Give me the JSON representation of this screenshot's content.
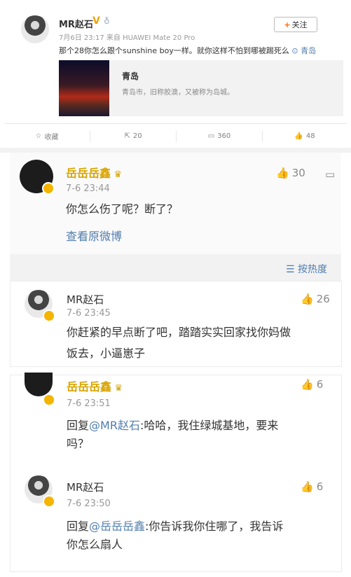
{
  "post": {
    "username": "MR赵石",
    "verified_badge": "V",
    "meta": "7月6日 23:17 来自 HUAWEI Mate 20 Pro",
    "follow_label": "关注",
    "text": "那个28你怎么跟个sunshine boy一样。就你这样不怕到哪被踢死么",
    "location": "青岛",
    "card": {
      "title": "青岛",
      "desc": "青岛市，旧称胶澳，又被称为岛城。"
    },
    "actions": {
      "favorite": "收藏",
      "repost": "20",
      "comment": "360",
      "like": "48"
    }
  },
  "comment_main": {
    "username": "岳岳岳鑫",
    "time": "7-6 23:44",
    "likes": "30",
    "text": "你怎么伤了呢？断了？",
    "view_original": "查看原微博"
  },
  "sort_label": "按热度",
  "replies": [
    {
      "username": "MR赵石",
      "time": "7-6 23:45",
      "likes": "26",
      "text_line1": "你赶紧的早点断了吧，踏踏实实回家找你妈做",
      "text_line2": "饭去，小逼崽子"
    },
    {
      "username": "岳岳岳鑫",
      "time": "7-6 23:51",
      "likes": "6",
      "reply_prefix": "回复",
      "mention": "@MR赵石",
      "text_line1": ":哈哈，我住绿城基地，要来",
      "text_line2": "吗？"
    },
    {
      "username": "MR赵石",
      "time": "7-6 23:50",
      "likes": "6",
      "reply_prefix": "回复",
      "mention": "@岳岳岳鑫",
      "text_line1": ":你告诉我你住哪了，我告诉",
      "text_line2": "你怎么扇人"
    }
  ]
}
